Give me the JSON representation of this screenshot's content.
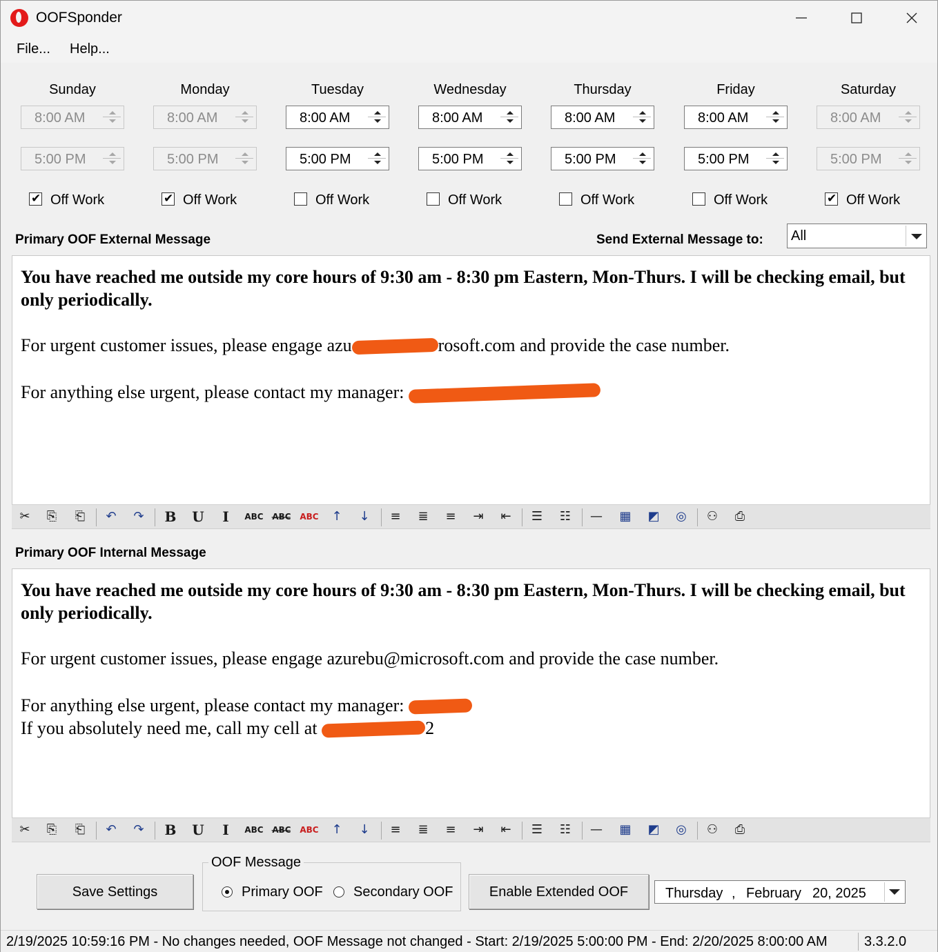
{
  "window": {
    "title": "OOFSponder"
  },
  "menu": [
    "File...",
    "Help..."
  ],
  "days": [
    {
      "name": "Sunday",
      "start": "8:00 AM",
      "end": "5:00 PM",
      "off_work": true,
      "enabled": false
    },
    {
      "name": "Monday",
      "start": "8:00 AM",
      "end": "5:00 PM",
      "off_work": true,
      "enabled": false
    },
    {
      "name": "Tuesday",
      "start": "8:00 AM",
      "end": "5:00 PM",
      "off_work": false,
      "enabled": true
    },
    {
      "name": "Wednesday",
      "start": "8:00 AM",
      "end": "5:00 PM",
      "off_work": false,
      "enabled": true
    },
    {
      "name": "Thursday",
      "start": "8:00 AM",
      "end": "5:00 PM",
      "off_work": false,
      "enabled": true
    },
    {
      "name": "Friday",
      "start": "8:00 AM",
      "end": "5:00 PM",
      "off_work": false,
      "enabled": true
    },
    {
      "name": "Saturday",
      "start": "8:00 AM",
      "end": "5:00 PM",
      "off_work": true,
      "enabled": false
    }
  ],
  "off_work_label": "Off Work",
  "external": {
    "label": "Primary OOF External Message",
    "send_to_label": "Send External Message to:",
    "send_to_value": "All",
    "line1": "You have reached me outside my core hours of 9:30 am - 8:30 pm Eastern, Mon-Thurs. I will be checking email, but only periodically.",
    "line2_prefix": "For urgent customer issues, please engage azu",
    "line2_suffix": "rosoft.com and provide the case number.",
    "line3_prefix": "For anything else urgent, please contact my manager: "
  },
  "internal": {
    "label": "Primary OOF Internal Message",
    "line1": "You have reached me outside my core hours of 9:30 am - 8:30 pm Eastern, Mon-Thurs. I will be checking email, but only periodically.",
    "line2": "For urgent customer issues, please engage azurebu@microsoft.com and provide the case number.",
    "line3_prefix": "For anything else urgent, please contact my manager: ",
    "line4_prefix": "If you absolutely need me, call my cell at ",
    "line4_suffix": "2"
  },
  "toolbar_icons": [
    "cut-icon",
    "copy-icon",
    "paste-icon",
    "undo-icon",
    "redo-icon",
    "bold-icon",
    "underline-icon",
    "italic-icon",
    "small-caps-icon",
    "strikethrough-icon",
    "font-color-icon",
    "sort-ascending-icon",
    "sort-descending-icon",
    "align-left-icon",
    "align-center-icon",
    "align-right-icon",
    "indent-icon",
    "outdent-icon",
    "bullet-list-icon",
    "numbered-list-icon",
    "horizontal-rule-icon",
    "table-icon",
    "insert-image-icon",
    "insert-link-icon",
    "find-icon",
    "print-icon"
  ],
  "bottom": {
    "save_button": "Save Settings",
    "group_title": "OOF Message",
    "radio_primary": "Primary OOF",
    "radio_secondary": "Secondary OOF",
    "extended_button": "Enable Extended OOF",
    "date_weekday": "Thursday",
    "date_comma": ",",
    "date_month": "February",
    "date_day_year": "20, 2025"
  },
  "status": {
    "text": "2/19/2025 10:59:16 PM - No changes needed, OOF Message not changed - Start: 2/19/2025 5:00:00 PM - End: 2/20/2025 8:00:00 AM",
    "version": "3.3.2.0"
  },
  "colors": {
    "redaction": "#f05a14",
    "app_icon": "#e31a1a"
  }
}
